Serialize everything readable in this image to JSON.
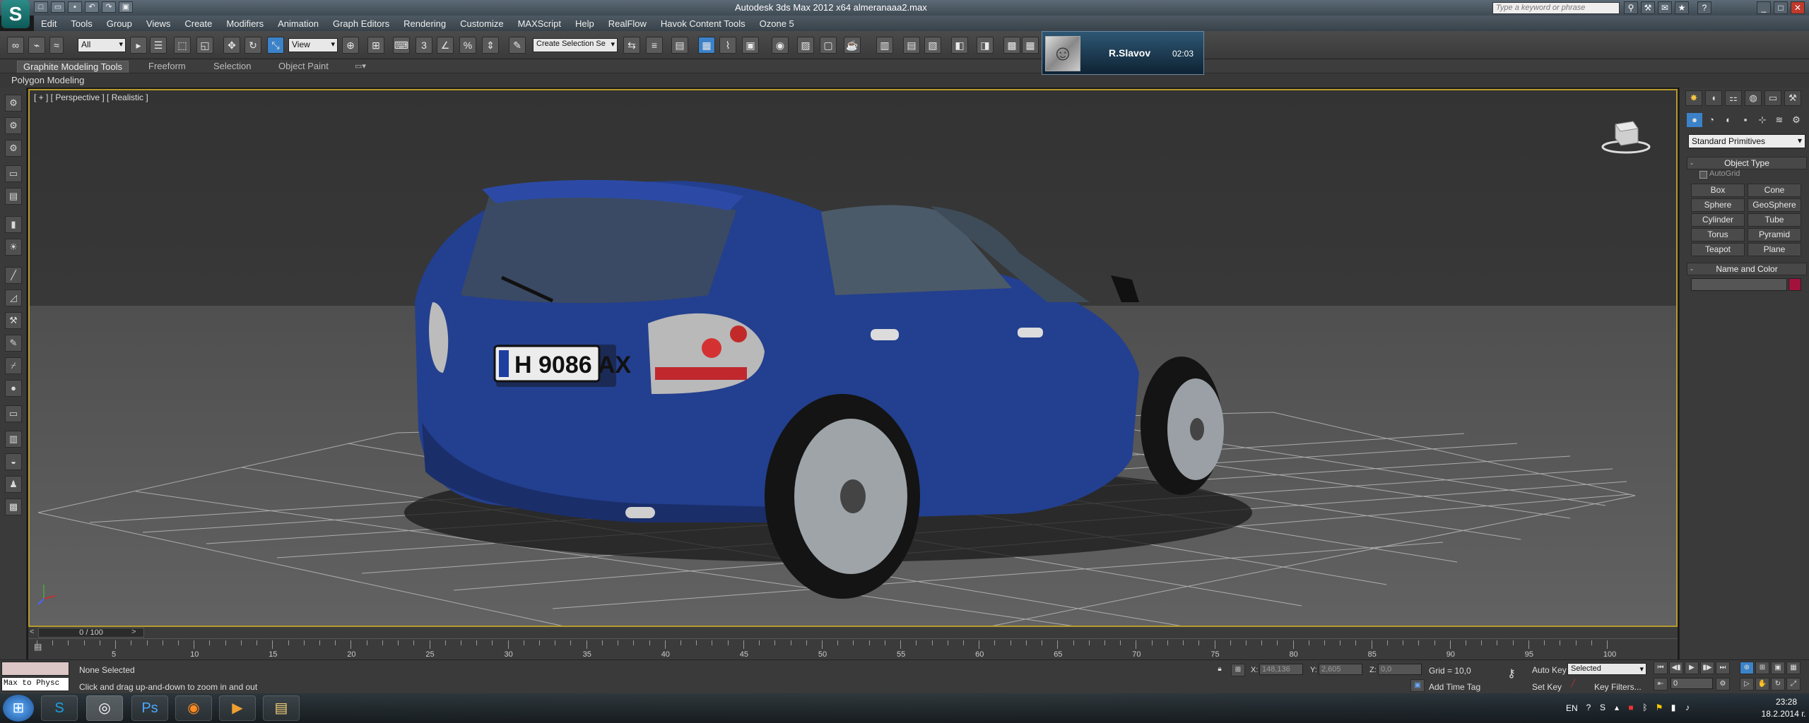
{
  "window": {
    "title": "Autodesk 3ds Max  2012 x64     almeranaaa2.max",
    "search_placeholder": "Type a keyword or phrase"
  },
  "menu": [
    "Edit",
    "Tools",
    "Group",
    "Views",
    "Create",
    "Modifiers",
    "Animation",
    "Graph Editors",
    "Rendering",
    "Customize",
    "MAXScript",
    "Help",
    "RealFlow",
    "Havok Content Tools",
    "Ozone 5"
  ],
  "toolbar": {
    "selection_filter": "All",
    "ref_coord": "View",
    "named_selection": "Create Selection Se"
  },
  "user_card": {
    "name": "R.Slavov",
    "time": "02:03"
  },
  "ribbon": {
    "tabs": [
      "Graphite Modeling Tools",
      "Freeform",
      "Selection",
      "Object Paint"
    ],
    "active_tab": "Graphite Modeling Tools",
    "sub_label": "Polygon Modeling"
  },
  "viewport": {
    "label": "[ + ] [ Perspective ] [ Realistic ]",
    "plate": "H 9086 AX"
  },
  "command_panel": {
    "category": "Standard Primitives",
    "object_type_title": "Object Type",
    "autogrid": "AutoGrid",
    "buttons": [
      "Box",
      "Cone",
      "Sphere",
      "GeoSphere",
      "Cylinder",
      "Tube",
      "Torus",
      "Pyramid",
      "Teapot",
      "Plane"
    ],
    "name_color_title": "Name and Color",
    "object_color": "#a3123c"
  },
  "timeline": {
    "slider": "0 / 100",
    "ticks": [
      "5",
      "10",
      "15",
      "20",
      "25",
      "30",
      "35",
      "40",
      "45",
      "50",
      "55",
      "60",
      "65",
      "70",
      "75",
      "80",
      "85",
      "90",
      "95",
      "100"
    ]
  },
  "status": {
    "selection": "None Selected",
    "prompt": "Click and drag up-and-down to zoom in and out",
    "x_label": "X:",
    "x_value": "148,136",
    "y_label": "Y:",
    "y_value": "2,605",
    "z_label": "Z:",
    "z_value": "0,0",
    "grid": "Grid = 10,0",
    "add_time_tag": "Add Time Tag",
    "auto_key": "Auto Key",
    "auto_key_mode": "Selected",
    "set_key": "Set Key",
    "key_filters": "Key Filters...",
    "frame": "0",
    "maxscript_output": "Max to Physc"
  },
  "taskbar": {
    "lang": "EN",
    "time": "23:28",
    "date": "18.2.2014 г."
  }
}
